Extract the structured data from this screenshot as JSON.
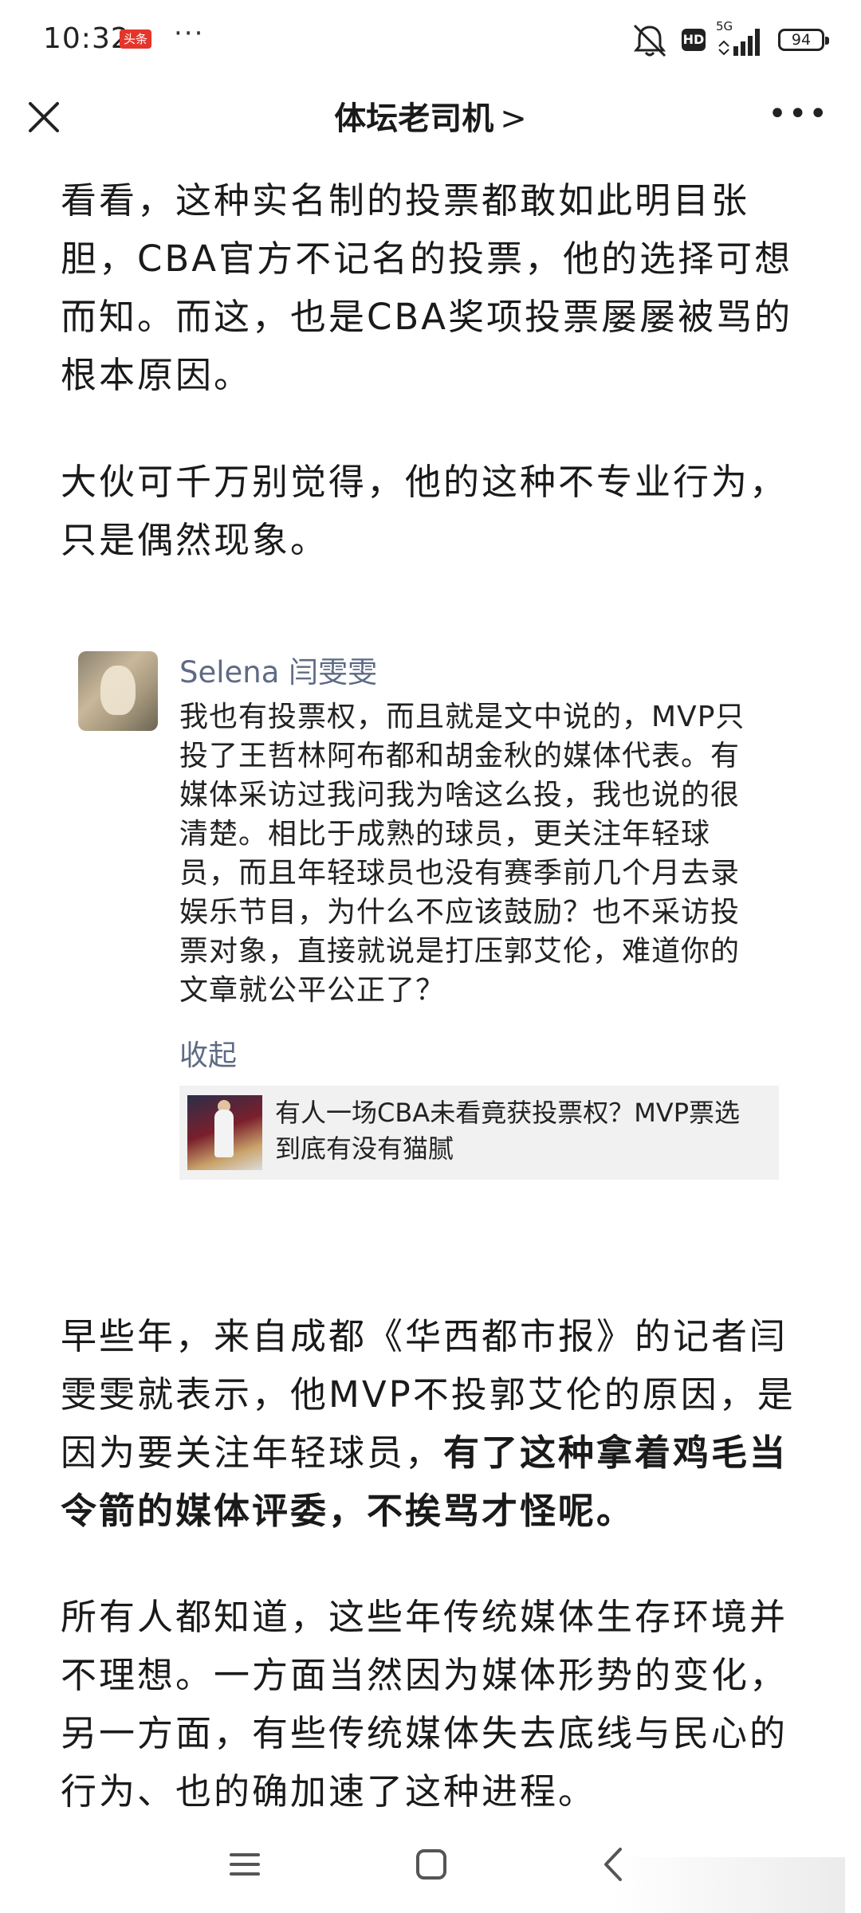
{
  "status_bar": {
    "time": "10:32",
    "app_badge": "头条",
    "more_dots": "···",
    "hd_label": "HD",
    "network": "5G",
    "battery": "94"
  },
  "nav": {
    "title": "体坛老司机",
    "chevron": ">",
    "more": "•••"
  },
  "article": {
    "para1": "看看，这种实名制的投票都敢如此明目张胆，CBA官方不记名的投票，他的选择可想而知。而这，也是CBA奖项投票屡屡被骂的根本原因。",
    "para2": "大伙可千万别觉得，他的这种不专业行为，只是偶然现象。",
    "para3_normal": "早些年，来自成都《华西都市报》的记者闫雯雯就表示，他MVP不投郭艾伦的原因，是因为要关注年轻球员，",
    "para3_bold": "有了这种拿着鸡毛当令箭的媒体评委，不挨骂才怪呢。",
    "para4": "所有人都知道，这些年传统媒体生存环境并不理想。一方面当然因为媒体形势的变化，另一方面，有些传统媒体失去底线与民心的行为、也的确加速了这种进程。"
  },
  "embedded_comment": {
    "author": "Selena 闫雯雯",
    "text": "我也有投票权，而且就是文中说的，MVP只投了王哲林阿布都和胡金秋的媒体代表。有媒体采访过我问我为啥这么投，我也说的很清楚。相比于成熟的球员，更关注年轻球员，而且年轻球员也没有赛季前几个月去录娱乐节目，为什么不应该鼓励？也不采访投票对象，直接就说是打压郭艾伦，难道你的文章就公平公正了？",
    "collapse_label": "收起",
    "linked_article_title": "有人一场CBA未看竟获投票权？MVP票选到底有没有猫腻"
  },
  "colors": {
    "link_blue": "#5d6b85",
    "badge_red": "#e5352b",
    "card_bg": "#f1f1f1"
  }
}
